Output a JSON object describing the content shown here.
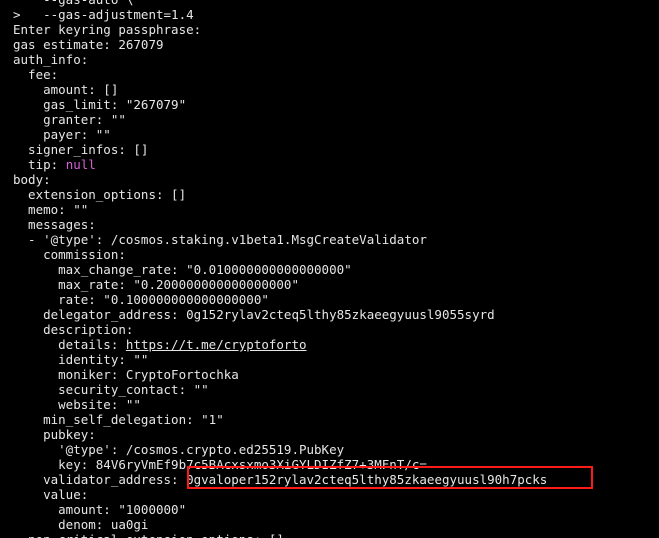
{
  "terminal": {
    "lines": [
      {
        "type": "plain",
        "text": "    --gas-auto \\"
      },
      {
        "type": "plain",
        "text": ">   --gas-adjustment=1.4"
      },
      {
        "type": "plain",
        "text": "Enter keyring passphrase:"
      },
      {
        "type": "plain",
        "text": "gas estimate: 267079"
      },
      {
        "type": "plain",
        "text": "auth_info:"
      },
      {
        "type": "plain",
        "text": "  fee:"
      },
      {
        "type": "plain",
        "text": "    amount: []"
      },
      {
        "type": "plain",
        "text": "    gas_limit: \"267079\""
      },
      {
        "type": "plain",
        "text": "    granter: \"\""
      },
      {
        "type": "plain",
        "text": "    payer: \"\""
      },
      {
        "type": "plain",
        "text": "  signer_infos: []"
      },
      {
        "type": "keyval",
        "key": "  tip: ",
        "value": "null"
      },
      {
        "type": "plain",
        "text": "body:"
      },
      {
        "type": "plain",
        "text": "  extension_options: []"
      },
      {
        "type": "plain",
        "text": "  memo: \"\""
      },
      {
        "type": "plain",
        "text": "  messages:"
      },
      {
        "type": "plain",
        "text": "  - '@type': /cosmos.staking.v1beta1.MsgCreateValidator"
      },
      {
        "type": "plain",
        "text": "    commission:"
      },
      {
        "type": "plain",
        "text": "      max_change_rate: \"0.010000000000000000\""
      },
      {
        "type": "plain",
        "text": "      max_rate: \"0.200000000000000000\""
      },
      {
        "type": "plain",
        "text": "      rate: \"0.100000000000000000\""
      },
      {
        "type": "plain",
        "text": "    delegator_address: 0g152rylav2cteq5lthy85zkaeegyuusl9055syrd"
      },
      {
        "type": "plain",
        "text": "    description:"
      },
      {
        "type": "link",
        "key": "      details: ",
        "value": "https://t.me/cryptoforto"
      },
      {
        "type": "plain",
        "text": "      identity: \"\""
      },
      {
        "type": "plain",
        "text": "      moniker: CryptoFortochka"
      },
      {
        "type": "plain",
        "text": "      security_contact: \"\""
      },
      {
        "type": "plain",
        "text": "      website: \"\""
      },
      {
        "type": "plain",
        "text": "    min_self_delegation: \"1\""
      },
      {
        "type": "plain",
        "text": "    pubkey:"
      },
      {
        "type": "plain",
        "text": "      '@type': /cosmos.crypto.ed25519.PubKey"
      },
      {
        "type": "plain",
        "text": "      key: 84V6ryVmEf9b7c5BAcxsxmo3XiGYLDIZfZ7+3MFnT/c="
      },
      {
        "type": "highlight",
        "key": "    validator_address: ",
        "value": "0gvaloper152rylav2cteq5lthy85zkaeegyuusl90h7pcks"
      },
      {
        "type": "plain",
        "text": "    value:"
      },
      {
        "type": "plain",
        "text": "      amount: \"1000000\""
      },
      {
        "type": "plain",
        "text": "      denom: ua0gi"
      },
      {
        "type": "plain",
        "text": "  non_critical_extension_options: []"
      }
    ]
  },
  "colors": {
    "background": "#000000",
    "foreground": "#e6e6e6",
    "keyword": "#d65ed6",
    "highlight_border": "#ff1a1a"
  }
}
